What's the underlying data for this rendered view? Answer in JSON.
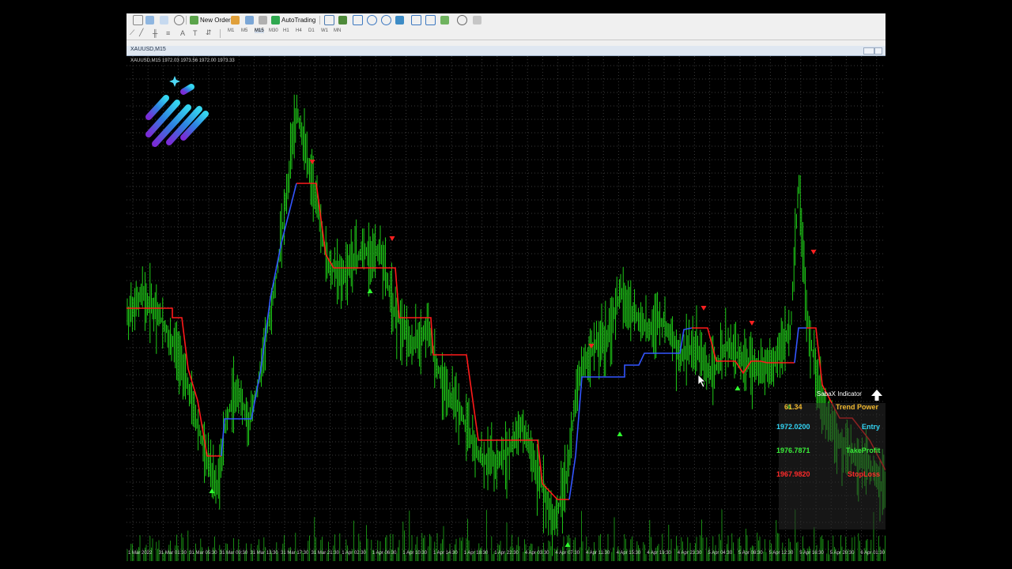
{
  "toolbar": {
    "new_order": "New Order",
    "autotrading": "AutoTrading",
    "timeframes": [
      "M1",
      "M5",
      "M15",
      "M30",
      "H1",
      "H4",
      "D1",
      "W1",
      "MN"
    ]
  },
  "window": {
    "title": "XAUUSD,M15"
  },
  "chart": {
    "header": "XAUUSD,M15  1972.03 1973.56 1972.00 1973.33",
    "price_color_up": "#22e11a",
    "trend_up_color": "#3355ff",
    "trend_down_color": "#ff1a1a",
    "grid_color": "#3a3a3a",
    "x_labels": [
      "1 Mar 2022",
      "31 Mar 01:30",
      "31 Mar 05:30",
      "31 Mar 09:30",
      "31 Mar 13:30",
      "31 Mar 17:30",
      "31 Mar 21:30",
      "1 Apr 02:30",
      "1 Apr 06:30",
      "1 Apr 10:30",
      "1 Apr 14:30",
      "1 Apr 18:30",
      "1 Apr 22:30",
      "4 Apr 03:30",
      "4 Apr 07:30",
      "4 Apr 11:30",
      "4 Apr 15:30",
      "4 Apr 19:30",
      "4 Apr 23:30",
      "5 Apr 04:30",
      "5 Apr 08:30",
      "5 Apr 12:30",
      "5 Apr 16:30",
      "5 Apr 20:30",
      "6 Apr 01:30"
    ]
  },
  "indicator": {
    "title": "SabaX Indicator",
    "trend_value": "61.34",
    "trend_label": "Trend Power",
    "entry_value": "1972.0200",
    "entry_label": "Entry",
    "tp_value": "1976.7871",
    "tp_label": "TakeProfit",
    "sl_value": "1967.9820",
    "sl_label": "StopLoss"
  }
}
